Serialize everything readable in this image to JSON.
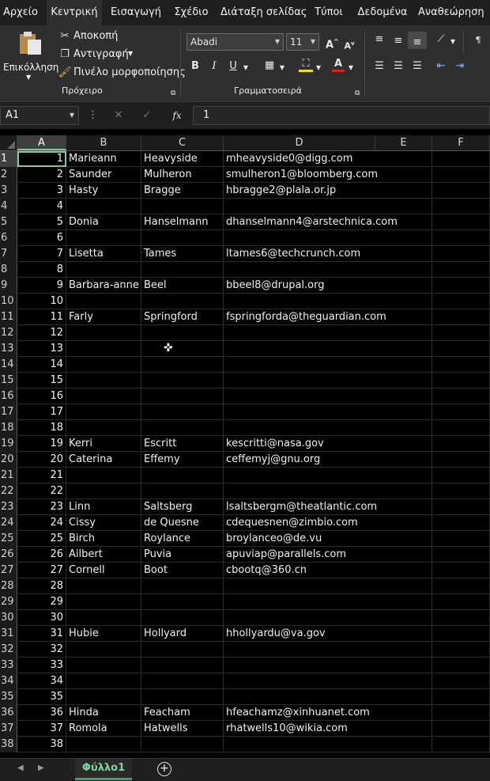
{
  "menu": {
    "tabs": [
      "Αρχείο",
      "Κεντρική",
      "Εισαγωγή",
      "Σχέδιο",
      "Διάταξη σελίδας",
      "Τύποι",
      "Δεδομένα",
      "Αναθεώρηση"
    ],
    "active": "Κεντρική"
  },
  "ribbon": {
    "paste_label": "Επικόλληση",
    "cut_label": "Αποκοπή",
    "copy_label": "Αντιγραφή",
    "format_painter_label": "Πινέλο μορφοποίησης",
    "clipboard_group": "Πρόχειρο",
    "font_name": "Abadi",
    "font_size": "11",
    "font_group": "Γραμματοσειρά",
    "bold": "B",
    "italic": "I",
    "underline": "U"
  },
  "formula_bar": {
    "name_box": "A1",
    "fx": "fx",
    "value": "1"
  },
  "columns": [
    "A",
    "B",
    "C",
    "D",
    "E",
    "F"
  ],
  "rows": [
    {
      "n": "1",
      "a": "1",
      "b": "Marieann",
      "c": "Heavyside",
      "d": "mheavyside0@digg.com"
    },
    {
      "n": "2",
      "a": "2",
      "b": "Saunder",
      "c": "Mulheron",
      "d": "smulheron1@bloomberg.com"
    },
    {
      "n": "3",
      "a": "3",
      "b": "Hasty",
      "c": "Bragge",
      "d": "hbragge2@plala.or.jp"
    },
    {
      "n": "4",
      "a": "4",
      "b": "",
      "c": "",
      "d": ""
    },
    {
      "n": "5",
      "a": "5",
      "b": "Donia",
      "c": "Hanselmann",
      "d": "dhanselmann4@arstechnica.com"
    },
    {
      "n": "6",
      "a": "6",
      "b": "",
      "c": "",
      "d": ""
    },
    {
      "n": "7",
      "a": "7",
      "b": "Lisetta",
      "c": "Tames",
      "d": "ltames6@techcrunch.com"
    },
    {
      "n": "8",
      "a": "8",
      "b": "",
      "c": "",
      "d": ""
    },
    {
      "n": "9",
      "a": "9",
      "b": "Barbara-anne",
      "c": "Beel",
      "d": "bbeel8@drupal.org"
    },
    {
      "n": "10",
      "a": "10",
      "b": "",
      "c": "",
      "d": ""
    },
    {
      "n": "11",
      "a": "11",
      "b": "Farly",
      "c": "Springford",
      "d": "fspringforda@theguardian.com"
    },
    {
      "n": "12",
      "a": "12",
      "b": "",
      "c": "",
      "d": ""
    },
    {
      "n": "13",
      "a": "13",
      "b": "",
      "c": "",
      "d": ""
    },
    {
      "n": "14",
      "a": "14",
      "b": "",
      "c": "",
      "d": ""
    },
    {
      "n": "15",
      "a": "15",
      "b": "",
      "c": "",
      "d": ""
    },
    {
      "n": "16",
      "a": "16",
      "b": "",
      "c": "",
      "d": ""
    },
    {
      "n": "17",
      "a": "17",
      "b": "",
      "c": "",
      "d": ""
    },
    {
      "n": "18",
      "a": "18",
      "b": "",
      "c": "",
      "d": ""
    },
    {
      "n": "19",
      "a": "19",
      "b": "Kerri",
      "c": "Escritt",
      "d": "kescritti@nasa.gov"
    },
    {
      "n": "20",
      "a": "20",
      "b": "Caterina",
      "c": "Effemy",
      "d": "ceffemyj@gnu.org"
    },
    {
      "n": "21",
      "a": "21",
      "b": "",
      "c": "",
      "d": ""
    },
    {
      "n": "22",
      "a": "22",
      "b": "",
      "c": "",
      "d": ""
    },
    {
      "n": "23",
      "a": "23",
      "b": "Linn",
      "c": "Saltsberg",
      "d": "lsaltsbergm@theatlantic.com"
    },
    {
      "n": "24",
      "a": "24",
      "b": "Cissy",
      "c": "de Quesne",
      "d": "cdequesnen@zimbio.com"
    },
    {
      "n": "25",
      "a": "25",
      "b": "Birch",
      "c": "Roylance",
      "d": "broylanceo@de.vu"
    },
    {
      "n": "26",
      "a": "26",
      "b": "Ailbert",
      "c": "Puvia",
      "d": "apuviap@parallels.com"
    },
    {
      "n": "27",
      "a": "27",
      "b": "Cornell",
      "c": "Boot",
      "d": "cbootq@360.cn"
    },
    {
      "n": "28",
      "a": "28",
      "b": "",
      "c": "",
      "d": ""
    },
    {
      "n": "29",
      "a": "29",
      "b": "",
      "c": "",
      "d": ""
    },
    {
      "n": "30",
      "a": "30",
      "b": "",
      "c": "",
      "d": ""
    },
    {
      "n": "31",
      "a": "31",
      "b": "Hubie",
      "c": "Hollyard",
      "d": "hhollyardu@va.gov"
    },
    {
      "n": "32",
      "a": "32",
      "b": "",
      "c": "",
      "d": ""
    },
    {
      "n": "33",
      "a": "33",
      "b": "",
      "c": "",
      "d": ""
    },
    {
      "n": "34",
      "a": "34",
      "b": "",
      "c": "",
      "d": ""
    },
    {
      "n": "35",
      "a": "35",
      "b": "",
      "c": "",
      "d": ""
    },
    {
      "n": "36",
      "a": "36",
      "b": "Hinda",
      "c": "Feacham",
      "d": "hfeachamz@xinhuanet.com"
    },
    {
      "n": "37",
      "a": "37",
      "b": "Romola",
      "c": "Hatwells",
      "d": "rhatwells10@wikia.com"
    },
    {
      "n": "38",
      "a": "38",
      "b": "",
      "c": "",
      "d": ""
    }
  ],
  "sheet": {
    "tab_label": "Φύλλο1",
    "add_icon": "+"
  },
  "colors": {
    "accent": "#8ac4a0",
    "sheet_tab": "#7ed3a0"
  }
}
